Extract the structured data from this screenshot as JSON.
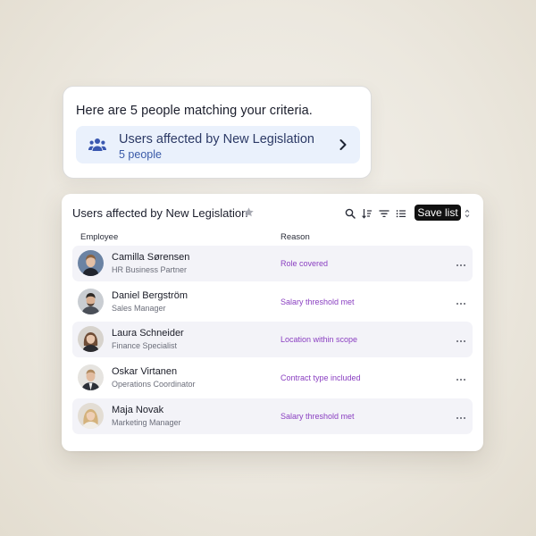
{
  "chat": {
    "message": "Here are 5 people matching your criteria.",
    "chip": {
      "icon": "people-icon",
      "title": "Users affected by New Legislation",
      "subtitle": "5 people",
      "chevron_icon": "chevron-right-icon"
    }
  },
  "list": {
    "title": "Users affected by New Legislation",
    "star_icon": "star-icon",
    "toolbar": {
      "icons": [
        "search-icon",
        "sort-icon",
        "filter-icon",
        "list-options-icon"
      ],
      "save_label": "Save list",
      "dropdown_icon": "sort-arrows-icon"
    },
    "columns": [
      "Employee",
      "Reason"
    ],
    "accent": "#8a3fc1",
    "rows": [
      {
        "name": "Camilla Sørensen",
        "role": "HR Business Partner",
        "reason": "Role covered"
      },
      {
        "name": "Daniel Bergström",
        "role": "Sales Manager",
        "reason": "Salary threshold met"
      },
      {
        "name": "Laura Schneider",
        "role": "Finance Specialist",
        "reason": "Location within scope"
      },
      {
        "name": "Oskar Virtanen",
        "role": "Operations Coordinator",
        "reason": "Contract type included"
      },
      {
        "name": "Maja Novak",
        "role": "Marketing Manager",
        "reason": "Salary threshold met"
      }
    ]
  }
}
